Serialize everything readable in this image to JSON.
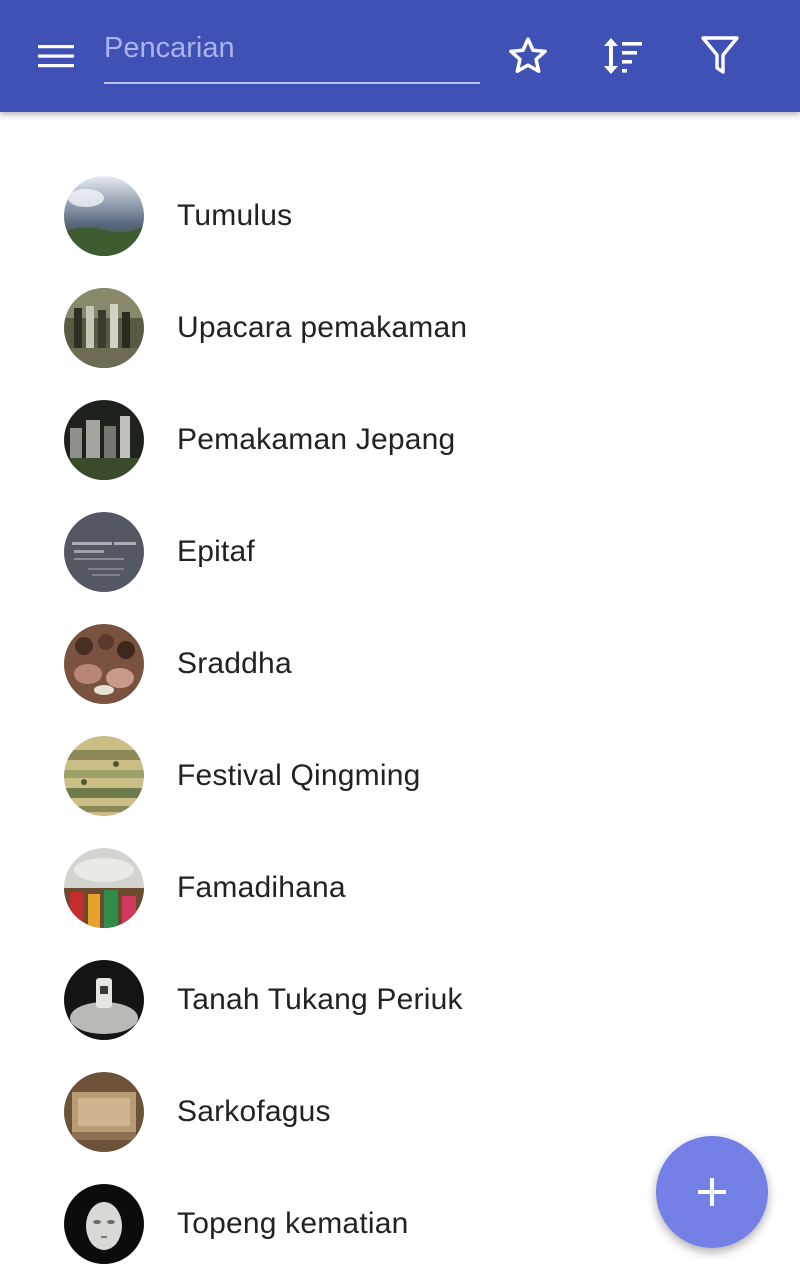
{
  "appbar": {
    "background": "#3f51b5",
    "menu_icon": "hamburger-menu-icon",
    "search": {
      "placeholder": "Pencarian",
      "value": ""
    },
    "actions": [
      {
        "name": "favorites",
        "icon": "star-outline-icon"
      },
      {
        "name": "sort",
        "icon": "sort-icon"
      },
      {
        "name": "filter",
        "icon": "filter-icon"
      }
    ]
  },
  "items": [
    {
      "label": "Tumulus",
      "thumb": "landscape-cloudy"
    },
    {
      "label": "Upacara pemakaman",
      "thumb": "funeral-procession"
    },
    {
      "label": "Pemakaman Jepang",
      "thumb": "japanese-graves"
    },
    {
      "label": "Epitaf",
      "thumb": "stone-inscription"
    },
    {
      "label": "Sraddha",
      "thumb": "ritual-gathering"
    },
    {
      "label": "Festival Qingming",
      "thumb": "scroll-painting"
    },
    {
      "label": "Famadihana",
      "thumb": "crowd-ceremony"
    },
    {
      "label": "Tanah Tukang Periuk",
      "thumb": "tomb-monument"
    },
    {
      "label": "Sarkofagus",
      "thumb": "stone-sarcophagus"
    },
    {
      "label": "Topeng kematian",
      "thumb": "death-mask"
    }
  ],
  "fab": {
    "icon": "plus-icon",
    "color": "#7480e5"
  }
}
